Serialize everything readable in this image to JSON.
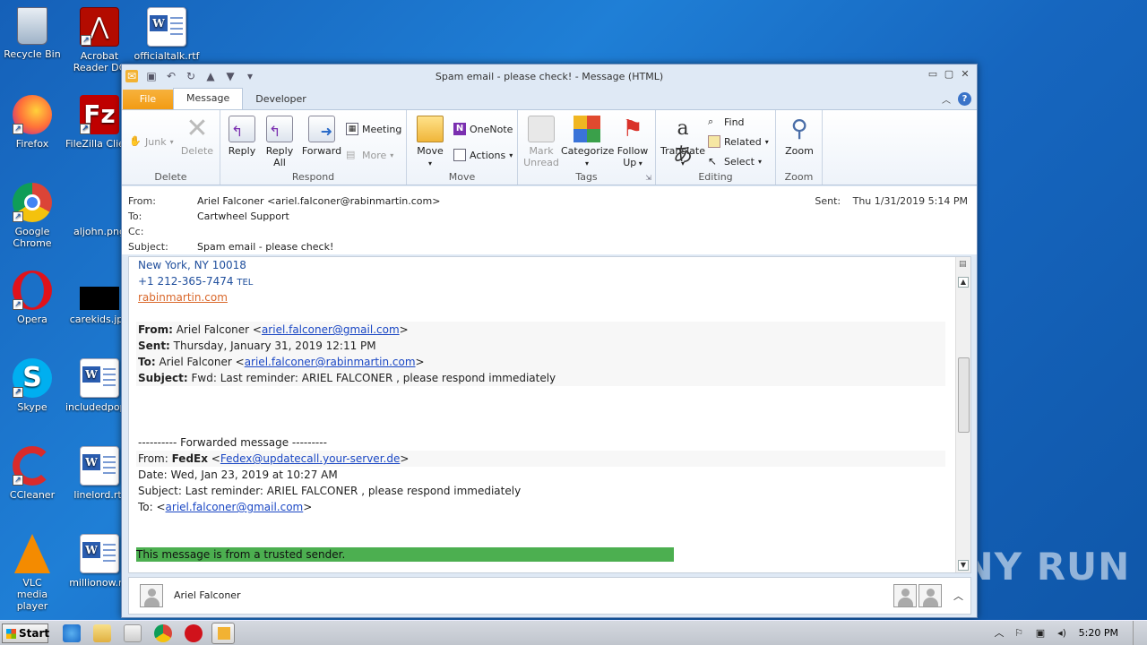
{
  "desktop": {
    "icons": [
      {
        "label": "Recycle Bin"
      },
      {
        "label": "Acrobat Reader DC"
      },
      {
        "label": "officialtalk.rtf"
      },
      {
        "label": "Firefox"
      },
      {
        "label": "FileZilla Client"
      },
      {
        "label": "Google Chrome"
      },
      {
        "label": "aljohn.png"
      },
      {
        "label": "Opera"
      },
      {
        "label": "carekids.jpg"
      },
      {
        "label": "Skype"
      },
      {
        "label": "includedpop.rtf"
      },
      {
        "label": "CCleaner"
      },
      {
        "label": "linelord.rtf"
      },
      {
        "label": "VLC media player"
      },
      {
        "label": "millionow.rtf"
      }
    ]
  },
  "window": {
    "title": "Spam email - please check!  -  Message (HTML)"
  },
  "tabs": [
    "File",
    "Message",
    "Developer"
  ],
  "ribbon": {
    "delete": {
      "name": "Delete",
      "junk": "Junk",
      "delete": "Delete"
    },
    "respond": {
      "name": "Respond",
      "reply": "Reply",
      "reply_all_1": "Reply",
      "reply_all_2": "All",
      "forward": "Forward",
      "meeting": "Meeting",
      "more": "More"
    },
    "move": {
      "name": "Move",
      "move": "Move",
      "onenote": "OneNote",
      "actions": "Actions"
    },
    "tags": {
      "name": "Tags",
      "mark_1": "Mark",
      "mark_2": "Unread",
      "categorize": "Categorize",
      "follow_1": "Follow",
      "follow_2": "Up"
    },
    "editing": {
      "name": "Editing",
      "translate": "Translate",
      "find": "Find",
      "related": "Related",
      "select": "Select"
    },
    "zoom": {
      "name": "Zoom",
      "zoom": "Zoom"
    }
  },
  "header": {
    "from_label": "From:",
    "from": "Ariel Falconer <ariel.falconer@rabinmartin.com>",
    "to_label": "To:",
    "to": "Cartwheel Support",
    "cc_label": "Cc:",
    "cc": "",
    "subject_label": "Subject:",
    "subject": "Spam email - please check!",
    "sent_label": "Sent:",
    "sent": "Thu 1/31/2019 5:14 PM"
  },
  "body": {
    "addr": "New York, NY 10018",
    "phone": "+1 212-365-7474",
    "phone_tag": "TEL",
    "site": "rabinmartin.com",
    "fw1": {
      "from_label": "From:",
      "from_name": " Ariel Falconer <",
      "from_email": "ariel.falconer@gmail.com",
      "from_end": ">",
      "sent_label": "Sent:",
      "sent": " Thursday, January 31, 2019 12:11 PM",
      "to_label": "To:",
      "to_name": " Ariel Falconer <",
      "to_email": "ariel.falconer@rabinmartin.com",
      "to_end": ">",
      "subject_label": "Subject:",
      "subject": " Fwd: Last reminder: ARIEL FALCONER , please respond immediately"
    },
    "fw_divider": "---------- Forwarded message ---------",
    "fw2": {
      "from_label": "From: ",
      "from_name": "FedEx",
      "from_open": " <",
      "from_email": "Fedex@updatecall.your-server.de",
      "from_end": ">",
      "date": "Date: Wed, Jan 23, 2019 at 10:27 AM",
      "subject": "Subject: Last reminder: ARIEL FALCONER , please respond immediately",
      "to_label": "To: <",
      "to_email": "ariel.falconer@gmail.com",
      "to_end": ">"
    },
    "trusted": "This message is from a trusted sender."
  },
  "people_pane": {
    "name": "Ariel Falconer"
  },
  "taskbar": {
    "start": "Start",
    "clock": "5:20 PM"
  },
  "watermark": "ANY RUN"
}
